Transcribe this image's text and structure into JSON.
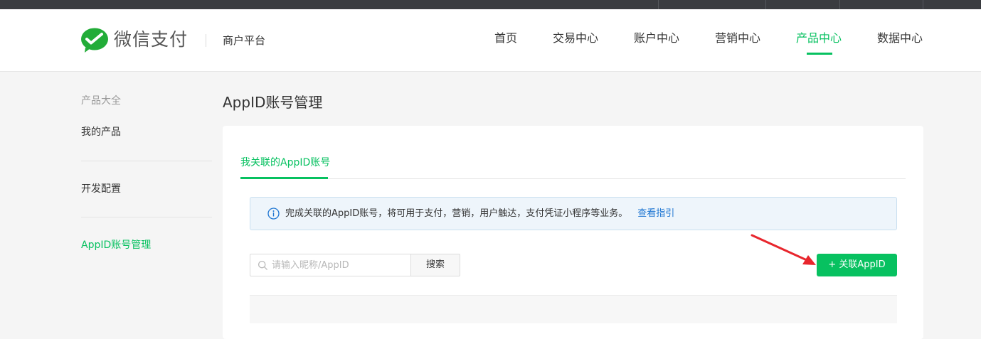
{
  "header": {
    "brand": "微信支付",
    "platform": "商户平台",
    "nav": [
      {
        "label": "首页",
        "active": false
      },
      {
        "label": "交易中心",
        "active": false
      },
      {
        "label": "账户中心",
        "active": false
      },
      {
        "label": "营销中心",
        "active": false
      },
      {
        "label": "产品中心",
        "active": true
      },
      {
        "label": "数据中心",
        "active": false
      }
    ]
  },
  "sidebar": {
    "group_label": "产品大全",
    "items": [
      {
        "label": "我的产品",
        "active": false
      },
      {
        "label": "开发配置",
        "active": false
      },
      {
        "label": "AppID账号管理",
        "active": true
      }
    ]
  },
  "main": {
    "title": "AppID账号管理",
    "tab": "我关联的AppID账号",
    "info": {
      "text": "完成关联的AppID账号，将可用于支付，营销，用户触达，支付凭证小程序等业务。",
      "link": "查看指引"
    },
    "search": {
      "placeholder": "请输入昵称/AppID",
      "button": "搜索"
    },
    "add_button": "+ 关联AppID"
  },
  "colors": {
    "accent": "#07c160",
    "link": "#1a73d1",
    "annotation_arrow": "#e8262d"
  }
}
